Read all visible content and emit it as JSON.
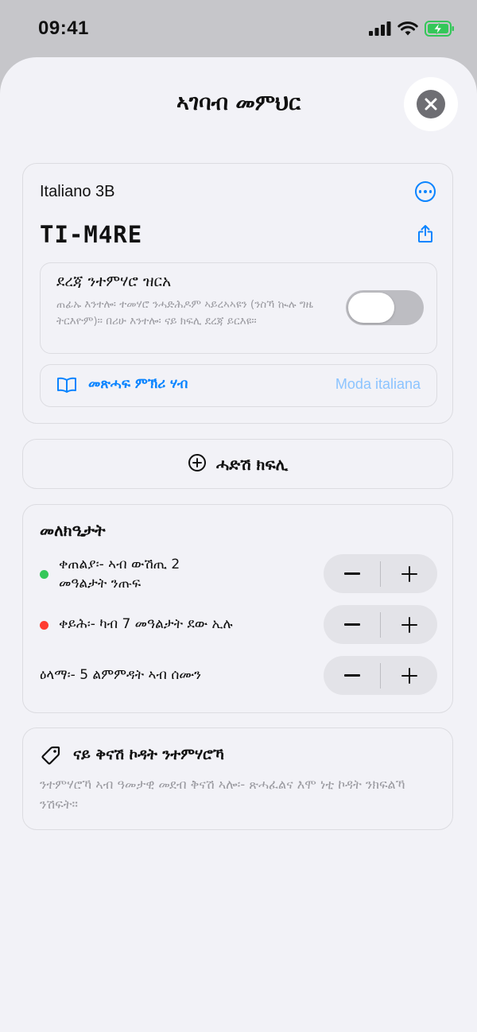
{
  "status_bar": {
    "time": "09:41"
  },
  "sheet": {
    "title": "ኣገባብ መምህር"
  },
  "class_card": {
    "class_name": "Italiano 3B",
    "class_code": "TI-M4RE",
    "level_section": {
      "title": "ደረጃ ንተምሃሮ ዝርአ",
      "description": "ጠፊኡ እንተሎ፡ ተመሃሮ ንሓድሕዶም ኣይረኣኣዩን (ንስኻ ኲሉ ግዜ ትርእዮም)። በሪሁ እንተሎ፡ ናይ ክፍሊ ደረጃ ይርእዩ።",
      "toggle_on": false
    },
    "textbook": {
      "label": "መጽሓፍ ምኽሪ ሃብ",
      "value": "Moda italiana"
    }
  },
  "add_class": {
    "label": "ሓድሽ ክፍሊ"
  },
  "notes": {
    "title": "መለክዒታት",
    "items": [
      {
        "text_line1": "ቀጠልያ፡- ኣብ ውሽጢ 2",
        "text_line2": "መዓልታት ንጡፍ",
        "dot_color": "#34c759"
      },
      {
        "text_line1": "ቀይሕ፡- ካብ 7 መዓልታት ደው ኢሉ",
        "text_line2": "",
        "dot_color": "#ff3b30"
      },
      {
        "text_line1": "ዕላማ፡- 5 ልምምዳት ኣብ ሰሙን",
        "text_line2": "",
        "dot_color": ""
      }
    ]
  },
  "tags": {
    "title": "ናይ ቅናሽ ኮዳት ንተምሃሮኻ",
    "description": "ንተምሃሮኻ ኣብ ዓመታዊ መደብ ቅናሽ ኣሎ፡- ጽሓፈልና እሞ ነቲ ኮዳት ንክፍልኻ ንሽፍት።"
  },
  "colors": {
    "accent": "#0a84ff",
    "sheet_bg": "#f2f2f7",
    "backdrop": "#c6c6ca",
    "battery": "#34c759"
  },
  "icons": [
    "signal-icon",
    "wifi-icon",
    "battery-charging-icon",
    "close-icon",
    "more-icon",
    "share-icon",
    "book-icon",
    "plus-circle-icon",
    "tag-icon",
    "minus-icon",
    "plus-icon"
  ]
}
